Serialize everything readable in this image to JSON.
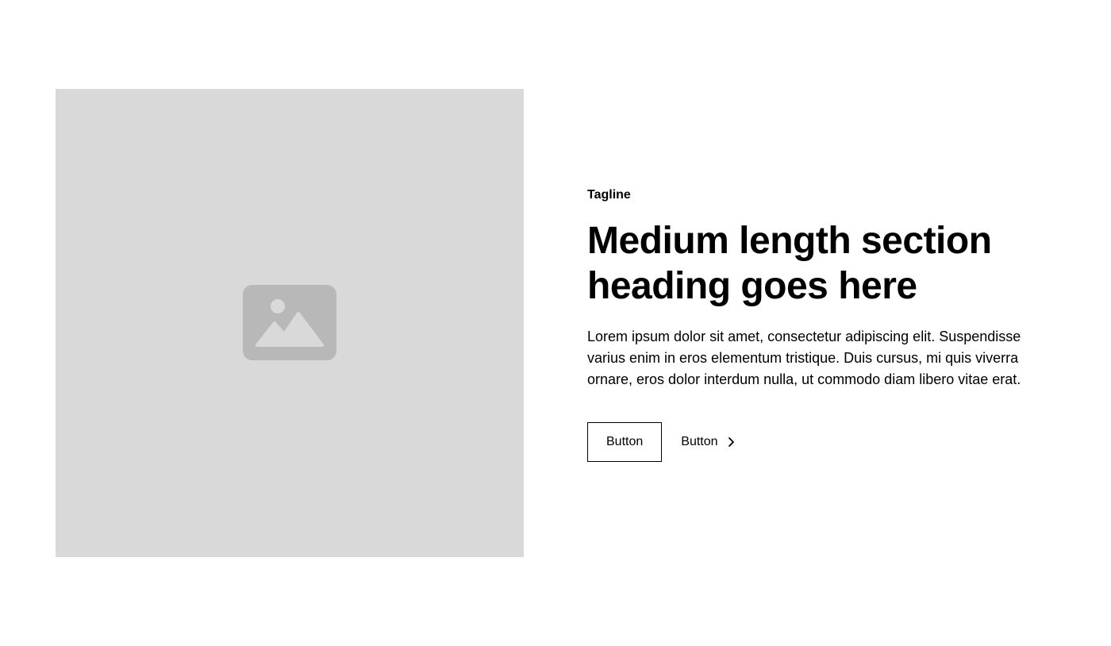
{
  "colors": {
    "background": "#ffffff",
    "placeholder_bg": "#d9d9d9",
    "placeholder_icon": "#b8b8b8",
    "text": "#000000"
  },
  "media": {
    "icon": "image-placeholder-icon"
  },
  "content": {
    "tagline": "Tagline",
    "heading": "Medium length section heading goes here",
    "body": "Lorem ipsum dolor sit amet, consectetur adipiscing elit. Suspendisse varius enim in eros elementum tristique. Duis cursus, mi quis viverra ornare, eros dolor interdum nulla, ut commodo diam libero vitae erat."
  },
  "actions": {
    "primary_label": "Button",
    "secondary_label": "Button",
    "secondary_icon": "chevron-right-icon"
  }
}
